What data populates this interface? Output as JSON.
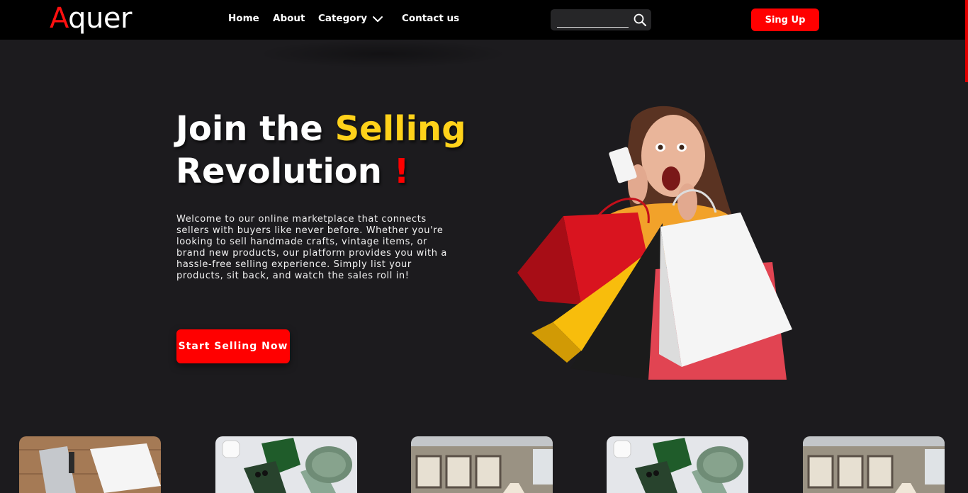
{
  "brand": {
    "logo_first": "A",
    "logo_rest": "quer"
  },
  "nav": {
    "home": "Home",
    "about": "About",
    "category": "Category",
    "contact": "Contact us"
  },
  "search": {
    "value": "",
    "placeholder": ""
  },
  "signup_label": "Sing Up",
  "hero": {
    "title_part1": "Join the ",
    "title_highlight": "Selling",
    "title_part2": "Revolution ",
    "title_bang": "!",
    "description": "Welcome to our online marketplace that connects sellers with buyers like never before. Whether you're looking to sell handmade crafts, vintage items, or brand new products, our platform provides you with a hassle-free selling experience. Simply list your products, sit back, and watch the sales roll in!",
    "cta_label": "Start Selling Now"
  },
  "colors": {
    "accent": "#ff0000",
    "highlight": "#ffd21a",
    "background": "#1c1b1e",
    "navbar": "#000000"
  },
  "icons": {
    "search": "search-icon",
    "category_dropdown": "chevron-down-icon"
  },
  "products": [
    {
      "image": "clothes-photo"
    },
    {
      "image": "phones-earbuds-photo"
    },
    {
      "image": "interior-room-photo"
    },
    {
      "image": "phones-earbuds-photo"
    },
    {
      "image": "interior-room-photo"
    }
  ]
}
